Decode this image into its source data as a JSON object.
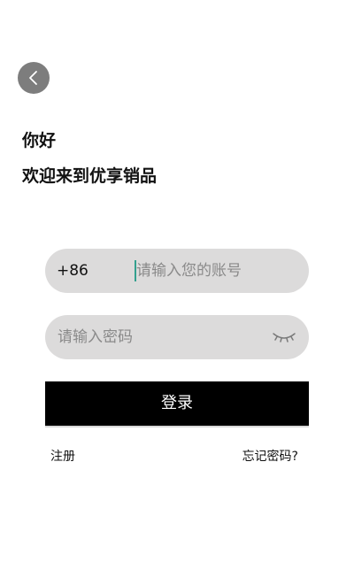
{
  "header": {
    "back_icon": "chevron-left-icon",
    "greeting": "你好",
    "welcome": "欢迎来到优享销品"
  },
  "form": {
    "account": {
      "country_code": "+86",
      "value": "",
      "placeholder": "请输入您的账号"
    },
    "password": {
      "value": "",
      "placeholder": "请输入密码",
      "toggle_icon": "eye-closed-icon"
    },
    "login_label": "登录"
  },
  "links": {
    "register": "注册",
    "forgot_password": "忘记密码?"
  },
  "colors": {
    "field_background": "#dcdbdb",
    "button_background": "#000000",
    "back_button": "#7d7d7d",
    "caret": "#33a08e"
  }
}
